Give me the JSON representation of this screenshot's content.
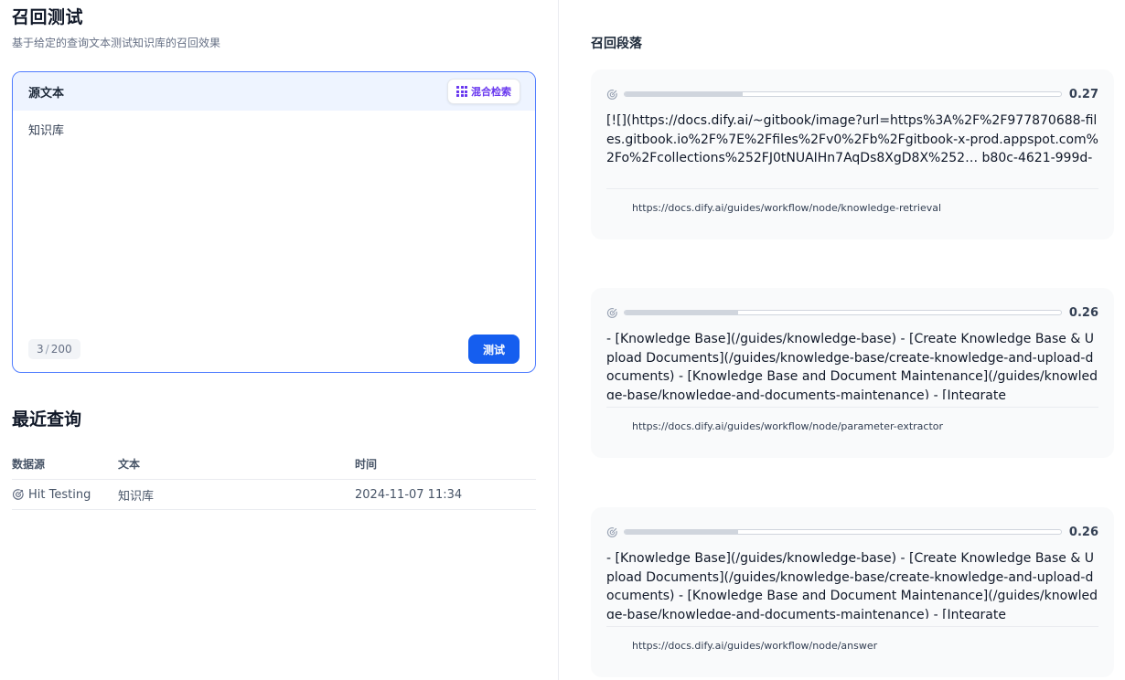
{
  "page": {
    "title": "召回测试",
    "description": "基于给定的查询文本测试知识库的召回效果"
  },
  "source": {
    "title": "源文本",
    "mode_label": "混合检索",
    "text": "知识库",
    "count_current": "3",
    "count_max": "200",
    "test_label": "测试"
  },
  "recent": {
    "title": "最近查询",
    "headers": {
      "source": "数据源",
      "text": "文本",
      "time": "时间"
    },
    "rows": [
      {
        "source": "Hit Testing",
        "text": "知识库",
        "time": "2024-11-07 11:34"
      }
    ]
  },
  "results": {
    "title": "召回段落",
    "items": [
      {
        "score": "0.27",
        "score_fraction": 0.27,
        "content": "[![](https://docs.dify.ai/~gitbook/image?url=https%3A%2F%2F977870688-files.gitbook.io%2F%7E%2Ffiles%2Fv0%2Fb%2Fgitbook-x-prod.appspot.com%2Fo%2Fcollections%252FJ0tNUAIHn7AqDs8XgD8X%252… b80c-4621-999d-",
        "source": "https://docs.dify.ai/guides/workflow/node/knowledge-retrieval"
      },
      {
        "score": "0.26",
        "score_fraction": 0.26,
        "content": "- [Knowledge Base](/guides/knowledge-base) - [Create Knowledge Base & Upload Documents](/guides/knowledge-base/create-knowledge-and-upload-documents) - [Knowledge Base and Document Maintenance](/guides/knowledge-base/knowledge-and-documents-maintenance) - [Integrate",
        "source": "https://docs.dify.ai/guides/workflow/node/parameter-extractor"
      },
      {
        "score": "0.26",
        "score_fraction": 0.26,
        "content": "- [Knowledge Base](/guides/knowledge-base) - [Create Knowledge Base & Upload Documents](/guides/knowledge-base/create-knowledge-and-upload-documents) - [Knowledge Base and Document Maintenance](/guides/knowledge-base/knowledge-and-documents-maintenance) - [Integrate",
        "source": "https://docs.dify.ai/guides/workflow/node/answer"
      }
    ]
  },
  "colors": {
    "primary": "#155eef",
    "mode_accent": "#6938ef",
    "source_header_bg": "#eef4ff",
    "card_bg": "#f9fafb"
  },
  "icons": {
    "mode": "grid-icon",
    "history_source": "target-icon",
    "score": "target-icon"
  }
}
